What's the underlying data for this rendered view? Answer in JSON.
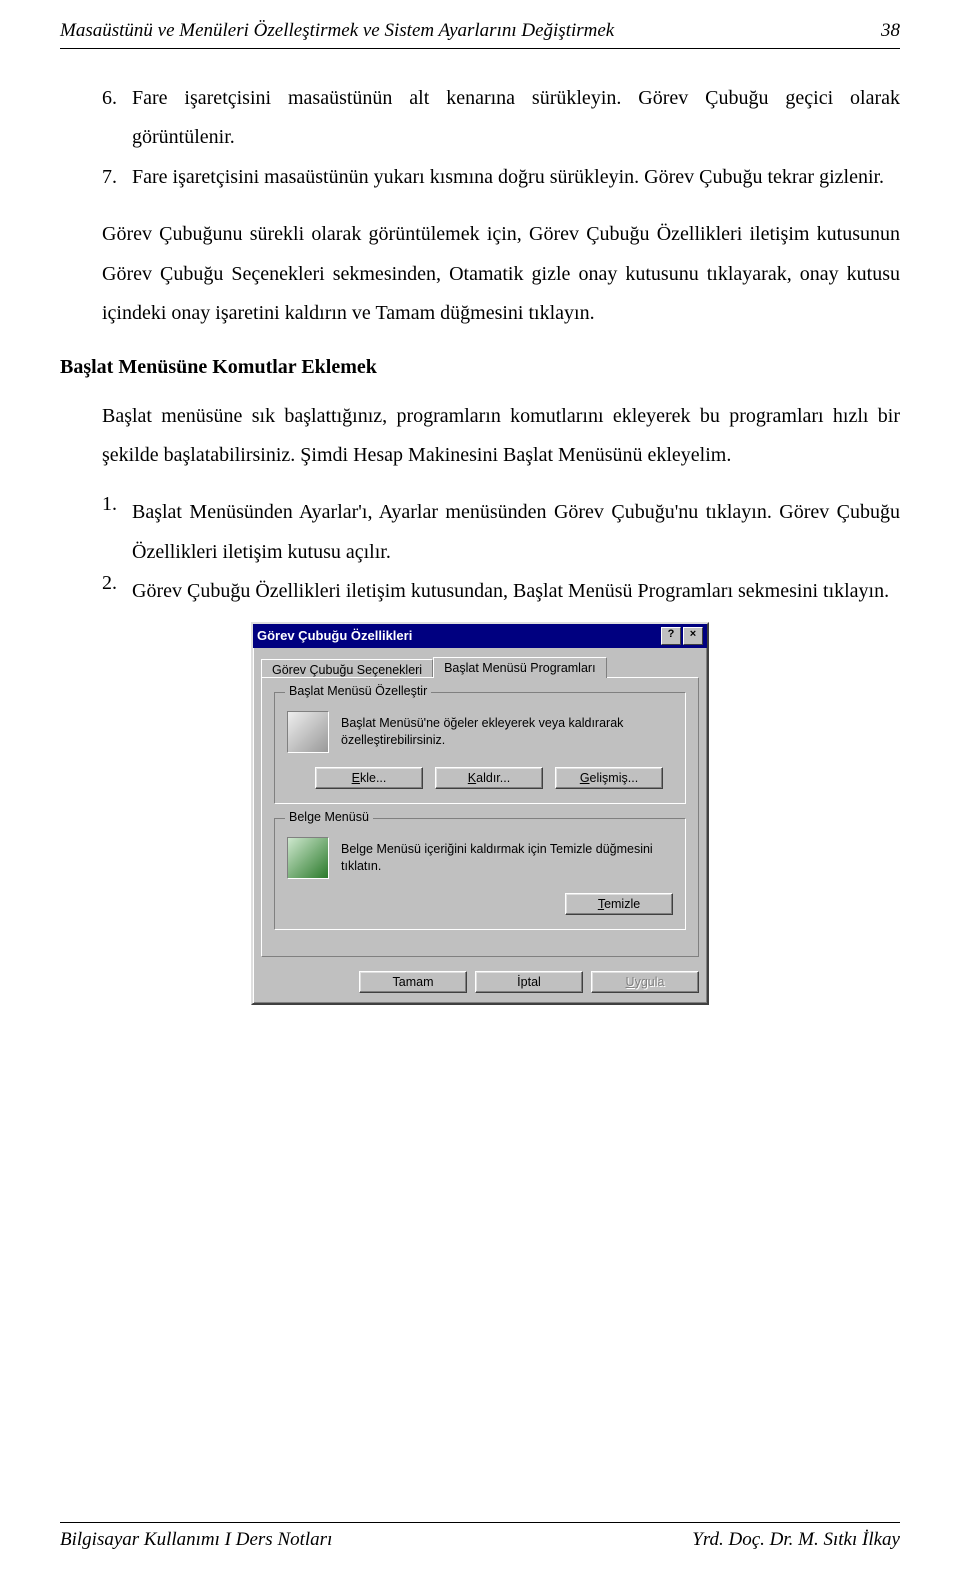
{
  "header": {
    "title": "Masaüstünü ve Menüleri Özelleştirmek ve Sistem Ayarlarını Değiştirmek",
    "page_no": "38"
  },
  "steps_a": {
    "n6": "6.",
    "t6": "Fare işaretçisini masaüstünün alt kenarına sürükleyin. Görev Çubuğu geçici olarak görüntülenir.",
    "n7": "7.",
    "t7": "Fare işaretçisini masaüstünün yukarı kısmına doğru sürükleyin. Görev Çubuğu tekrar gizlenir."
  },
  "middle_p": "Görev Çubuğunu sürekli olarak görüntülemek için, Görev Çubuğu Özellikleri iletişim kutusunun Görev Çubuğu Seçenekleri sekmesinden, Otamatik gizle onay kutusunu tıklayarak, onay kutusu içindeki onay işaretini kaldırın ve Tamam düğmesini tıklayın.",
  "section_head": "Başlat Menüsüne Komutlar Eklemek",
  "intro_p": "Başlat menüsüne sık başlattığınız, programların komutlarını ekleyerek bu programları hızlı bir şekilde başlatabilirsiniz. Şimdi Hesap Makinesini Başlat Menüsünü ekleyelim.",
  "steps_b": {
    "n1": "1.",
    "t1": "Başlat Menüsünden Ayarlar'ı, Ayarlar menüsünden Görev Çubuğu'nu tıklayın. Görev Çubuğu Özellikleri iletişim kutusu açılır.",
    "n2": "2.",
    "t2": "Görev Çubuğu Özellikleri iletişim kutusundan, Başlat Menüsü Programları sekmesini tıklayın."
  },
  "dialog": {
    "title": "Görev Çubuğu Özellikleri",
    "help_btn": "?",
    "close_btn": "×",
    "tab_inactive": "Görev Çubuğu Seçenekleri",
    "tab_active": "Başlat Menüsü Programları",
    "group1_title": "Başlat Menüsü Özelleştir",
    "group1_text": "Başlat Menüsü'ne öğeler ekleyerek veya kaldırarak özelleştirebilirsiniz.",
    "btn_ekle_pref": "E",
    "btn_ekle_rest": "kle...",
    "btn_kaldir_pref": "K",
    "btn_kaldir_rest": "aldır...",
    "btn_gelismis_pref": "G",
    "btn_gelismis_rest": "elişmiş...",
    "group2_title": "Belge Menüsü",
    "group2_text": "Belge Menüsü içeriğini kaldırmak için Temizle düğmesini tıklatın.",
    "btn_temizle_pref": "T",
    "btn_temizle_rest": "emizle",
    "btn_tamam": "Tamam",
    "btn_iptal": "İptal",
    "btn_uygula_pref": "U",
    "btn_uygula_rest": "ygula"
  },
  "footer": {
    "left": "Bilgisayar Kullanımı I Ders Notları",
    "right": "Yrd. Doç. Dr. M. Sıtkı İlkay"
  }
}
